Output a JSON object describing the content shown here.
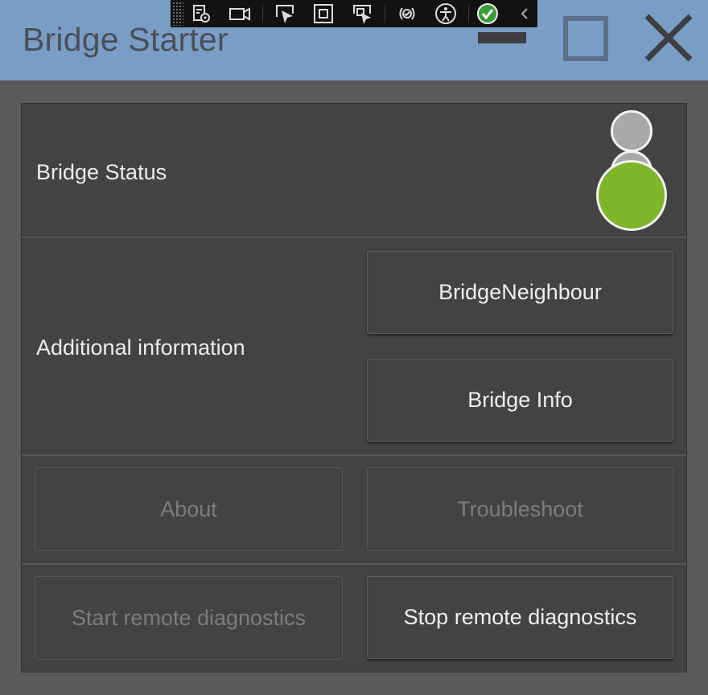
{
  "window": {
    "title": "Bridge Starter",
    "titlebar_color": "#7a9dc6"
  },
  "devtools_toolbar": {
    "icons": [
      "live-visual-tree-icon",
      "video-record-icon",
      "select-element-icon",
      "display-layout-adorners-icon",
      "track-focus-icon",
      "hot-reload-icon",
      "accessibility-icon",
      "binding-check-icon",
      "collapse-chevron-icon"
    ]
  },
  "status": {
    "label": "Bridge Status",
    "active_color": "#7fb52b",
    "inactive_color": "#a9a9a9"
  },
  "additional": {
    "label": "Additional information",
    "neighbour_button": "BridgeNeighbour",
    "info_button": "Bridge Info"
  },
  "actions": {
    "about_button": "About",
    "troubleshoot_button": "Troubleshoot",
    "start_diag_button": "Start remote diagnostics",
    "stop_diag_button": "Stop remote diagnostics"
  }
}
